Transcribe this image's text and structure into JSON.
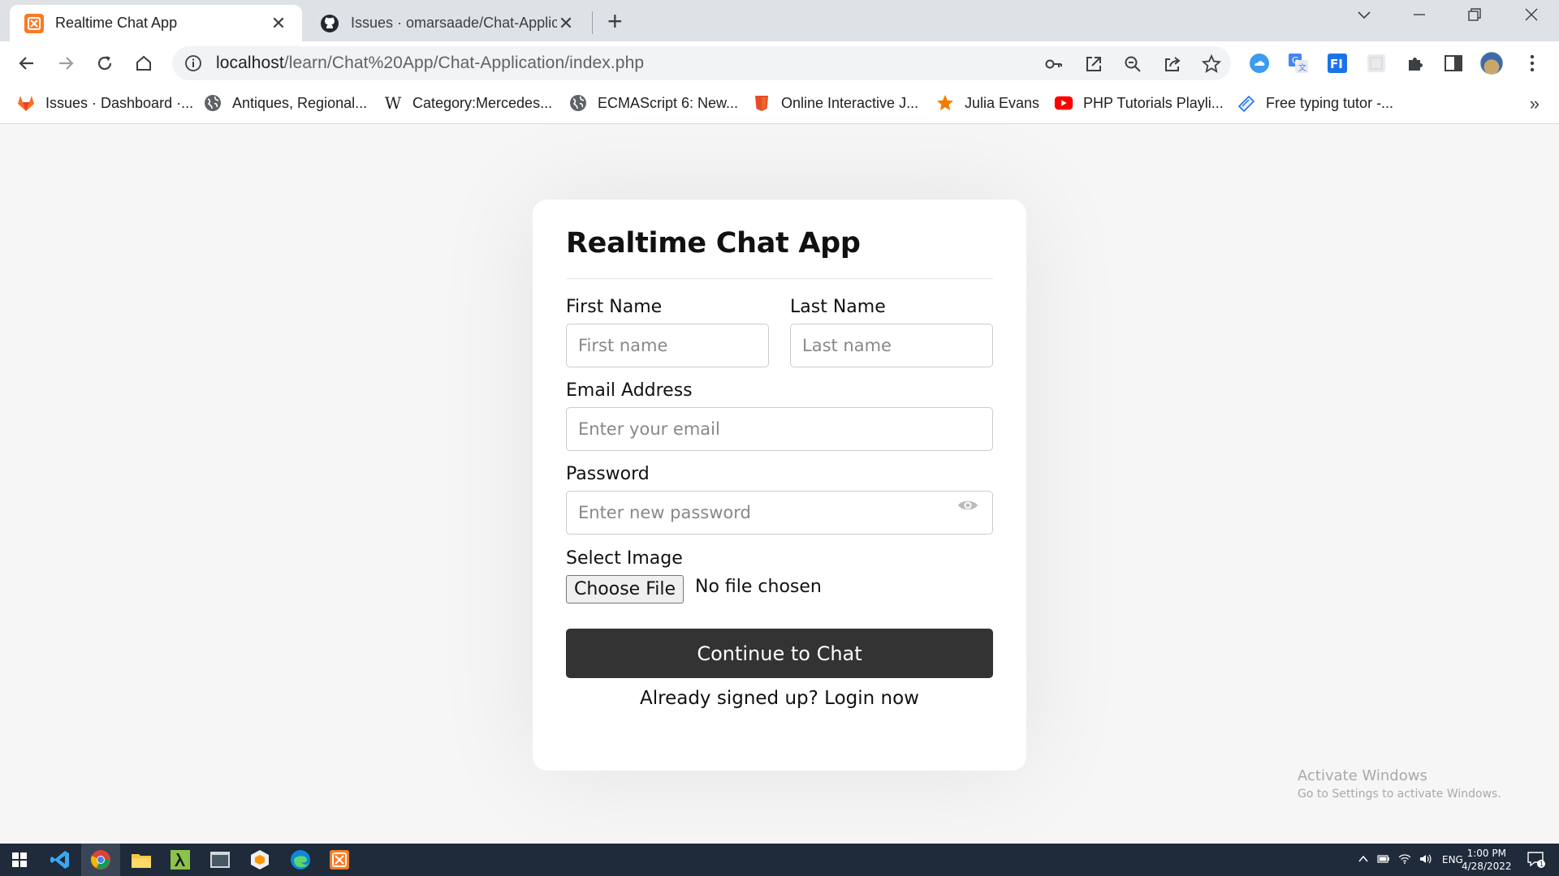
{
  "browser": {
    "tabs": [
      {
        "title": "Realtime Chat App",
        "active": true
      },
      {
        "title": "Issues · omarsaade/Chat-Applica",
        "active": false
      }
    ],
    "url": {
      "host": "localhost",
      "path": "/learn/Chat%20App/Chat-Application/index.php"
    },
    "bookmarks": [
      {
        "label": "Issues · Dashboard ·...",
        "icon": "gitlab-icon"
      },
      {
        "label": "Antiques, Regional...",
        "icon": "globe-icon"
      },
      {
        "label": "Category:Mercedes...",
        "icon": "wikipedia-icon"
      },
      {
        "label": "ECMAScript 6: New...",
        "icon": "globe-icon"
      },
      {
        "label": "Online Interactive J...",
        "icon": "shield-icon"
      },
      {
        "label": "Julia Evans",
        "icon": "star-icon"
      },
      {
        "label": "PHP Tutorials Playli...",
        "icon": "youtube-icon"
      },
      {
        "label": "Free typing tutor -...",
        "icon": "keyboard-icon"
      }
    ],
    "more": "»"
  },
  "form": {
    "title": "Realtime Chat App",
    "first_name": {
      "label": "First Name",
      "placeholder": "First name"
    },
    "last_name": {
      "label": "Last Name",
      "placeholder": "Last name"
    },
    "email": {
      "label": "Email Address",
      "placeholder": "Enter your email"
    },
    "password": {
      "label": "Password",
      "placeholder": "Enter new password"
    },
    "image": {
      "label": "Select Image",
      "button": "Choose File",
      "status": "No file chosen"
    },
    "submit": "Continue to Chat",
    "signup_prompt": "Already signed up?",
    "login_link": "Login now"
  },
  "watermark": {
    "line1": "Activate Windows",
    "line2": "Go to Settings to activate Windows."
  },
  "taskbar": {
    "lang": "ENG",
    "time": "1:00 PM",
    "date": "4/28/2022",
    "notifications": "1"
  }
}
